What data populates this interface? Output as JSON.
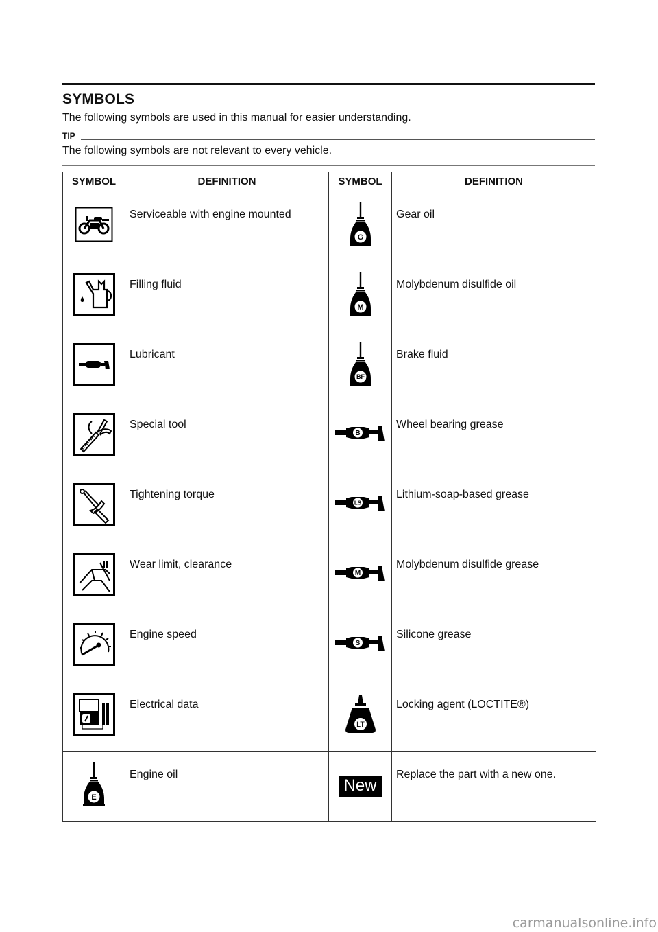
{
  "section": {
    "title": "SYMBOLS",
    "intro": "The following symbols are used in this manual for easier understanding."
  },
  "tip": {
    "label": "TIP",
    "text": "The following symbols are not relevant to every vehicle."
  },
  "table": {
    "headers": [
      "SYMBOL",
      "DEFINITION",
      "SYMBOL",
      "DEFINITION"
    ],
    "rows": [
      {
        "left": {
          "icon": "motorcycle-icon",
          "definition": "Serviceable with engine mounted"
        },
        "right": {
          "icon": "oil-can-icon",
          "letter": "G",
          "definition": "Gear oil"
        }
      },
      {
        "left": {
          "icon": "filling-fluid-icon",
          "definition": "Filling fluid"
        },
        "right": {
          "icon": "oil-can-icon",
          "letter": "M",
          "definition": "Molybdenum disulfide oil"
        }
      },
      {
        "left": {
          "icon": "lubricant-icon",
          "definition": "Lubricant"
        },
        "right": {
          "icon": "oil-can-icon",
          "letter": "BF",
          "definition": "Brake fluid"
        }
      },
      {
        "left": {
          "icon": "special-tool-icon",
          "definition": "Special tool"
        },
        "right": {
          "icon": "grease-gun-icon",
          "letter": "B",
          "definition": "Wheel bearing grease"
        }
      },
      {
        "left": {
          "icon": "torque-wrench-icon",
          "definition": "Tightening torque"
        },
        "right": {
          "icon": "grease-gun-icon",
          "letter": "LS",
          "definition": "Lithium-soap-based grease"
        }
      },
      {
        "left": {
          "icon": "caliper-icon",
          "definition": "Wear limit, clearance"
        },
        "right": {
          "icon": "grease-gun-icon",
          "letter": "M",
          "definition": "Molybdenum disulfide grease"
        }
      },
      {
        "left": {
          "icon": "tachometer-icon",
          "definition": "Engine speed"
        },
        "right": {
          "icon": "grease-gun-icon",
          "letter": "S",
          "definition": "Silicone grease"
        }
      },
      {
        "left": {
          "icon": "multimeter-icon",
          "definition": "Electrical data"
        },
        "right": {
          "icon": "locking-agent-bottle-icon",
          "letter": "LT",
          "definition": "Locking agent (LOCTITE®)"
        }
      },
      {
        "left": {
          "icon": "oil-can-icon",
          "letter": "E",
          "definition": "Engine oil"
        },
        "right": {
          "icon": "new-badge-icon",
          "letter": "New",
          "definition": "Replace the part with a new one."
        }
      }
    ]
  },
  "watermark": "carmanualsonline.info"
}
